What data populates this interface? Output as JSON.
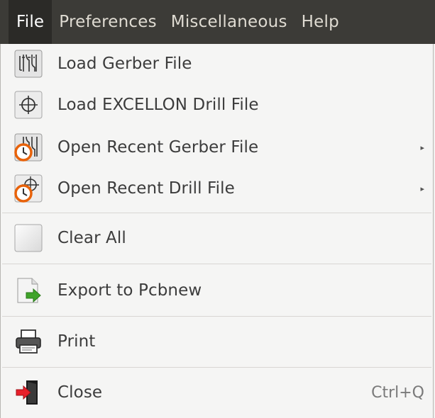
{
  "menubar": {
    "items": [
      {
        "label": "File"
      },
      {
        "label": "Preferences"
      },
      {
        "label": "Miscellaneous"
      },
      {
        "label": "Help"
      }
    ],
    "active_color": "#2b2a27",
    "bar_color": "#3c3b37"
  },
  "file_menu": {
    "items": [
      {
        "label": "Load Gerber File",
        "icon": "gerber-file-icon",
        "submenu": false
      },
      {
        "label": "Load EXCELLON Drill File",
        "icon": "drill-target-icon",
        "submenu": false
      },
      {
        "label": "Open Recent Gerber File",
        "icon": "recent-gerber-icon",
        "submenu": true
      },
      {
        "label": "Open Recent Drill File",
        "icon": "recent-drill-icon",
        "submenu": true
      },
      {
        "label": "Clear All",
        "icon": "blank-icon",
        "submenu": false
      },
      {
        "label": "Export to Pcbnew",
        "icon": "export-pcbnew-icon",
        "submenu": false
      },
      {
        "label": "Print",
        "icon": "printer-icon",
        "submenu": false
      },
      {
        "label": "Close",
        "icon": "exit-door-icon",
        "submenu": false,
        "shortcut": "Ctrl+Q"
      }
    ],
    "submenu_arrow": "▸"
  }
}
